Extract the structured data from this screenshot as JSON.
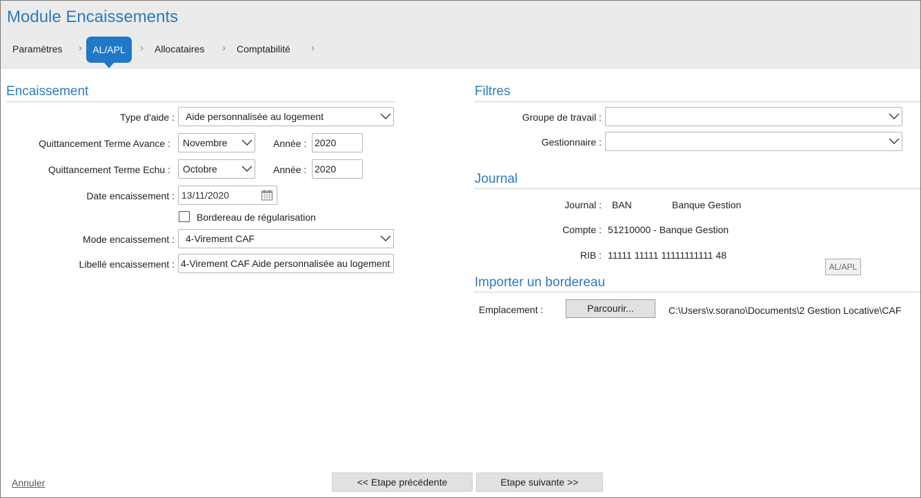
{
  "header": {
    "title": "Module Encaissements",
    "breadcrumb": [
      {
        "label": "Paramètres",
        "active": false
      },
      {
        "label": "AL/APL",
        "active": true
      },
      {
        "label": "Allocataires",
        "active": false
      },
      {
        "label": "Comptabilité",
        "active": false
      }
    ]
  },
  "encaissement": {
    "title": "Encaissement",
    "type_aide": {
      "label": "Type d'aide :",
      "value": "Aide personnalisée au logement"
    },
    "terme_avance": {
      "label": "Quittancement Terme Avance :",
      "month": "Novembre",
      "year_label": "Année :",
      "year": "2020"
    },
    "terme_echu": {
      "label": "Quittancement Terme Echu :",
      "month": "Octobre",
      "year_label": "Année :",
      "year": "2020"
    },
    "date": {
      "label": "Date encaissement :",
      "value": "13/11/2020"
    },
    "bordereau_regul": {
      "label": "Bordereau de régularisation",
      "checked": false
    },
    "mode": {
      "label": "Mode encaissement :",
      "value": "4-Virement CAF"
    },
    "libelle": {
      "label": "Libellé encaissement :",
      "value": "4-Virement CAF Aide personnalisée au logement"
    }
  },
  "filtres": {
    "title": "Filtres",
    "groupe": {
      "label": "Groupe de travail :",
      "value": ""
    },
    "gestionnaire": {
      "label": "Gestionnaire :",
      "value": ""
    }
  },
  "journal": {
    "title": "Journal",
    "journal_label": "Journal :",
    "journal_code": "BAN",
    "journal_name": "Banque Gestion",
    "compte_label": "Compte :",
    "compte_value": "51210000 - Banque Gestion",
    "rib_label": "RIB :",
    "rib_value": "11111 11111 11111111111 48",
    "tag_button": "AL/APL"
  },
  "import": {
    "title": "Importer un bordereau",
    "location_label": "Emplacement :",
    "browse_button": "Parcourir...",
    "path": "C:\\Users\\v.sorano\\Documents\\2 Gestion Locative\\CAF"
  },
  "footer": {
    "cancel": "Annuler",
    "previous": "<< Etape précédente",
    "next": "Etape suivante >>"
  }
}
